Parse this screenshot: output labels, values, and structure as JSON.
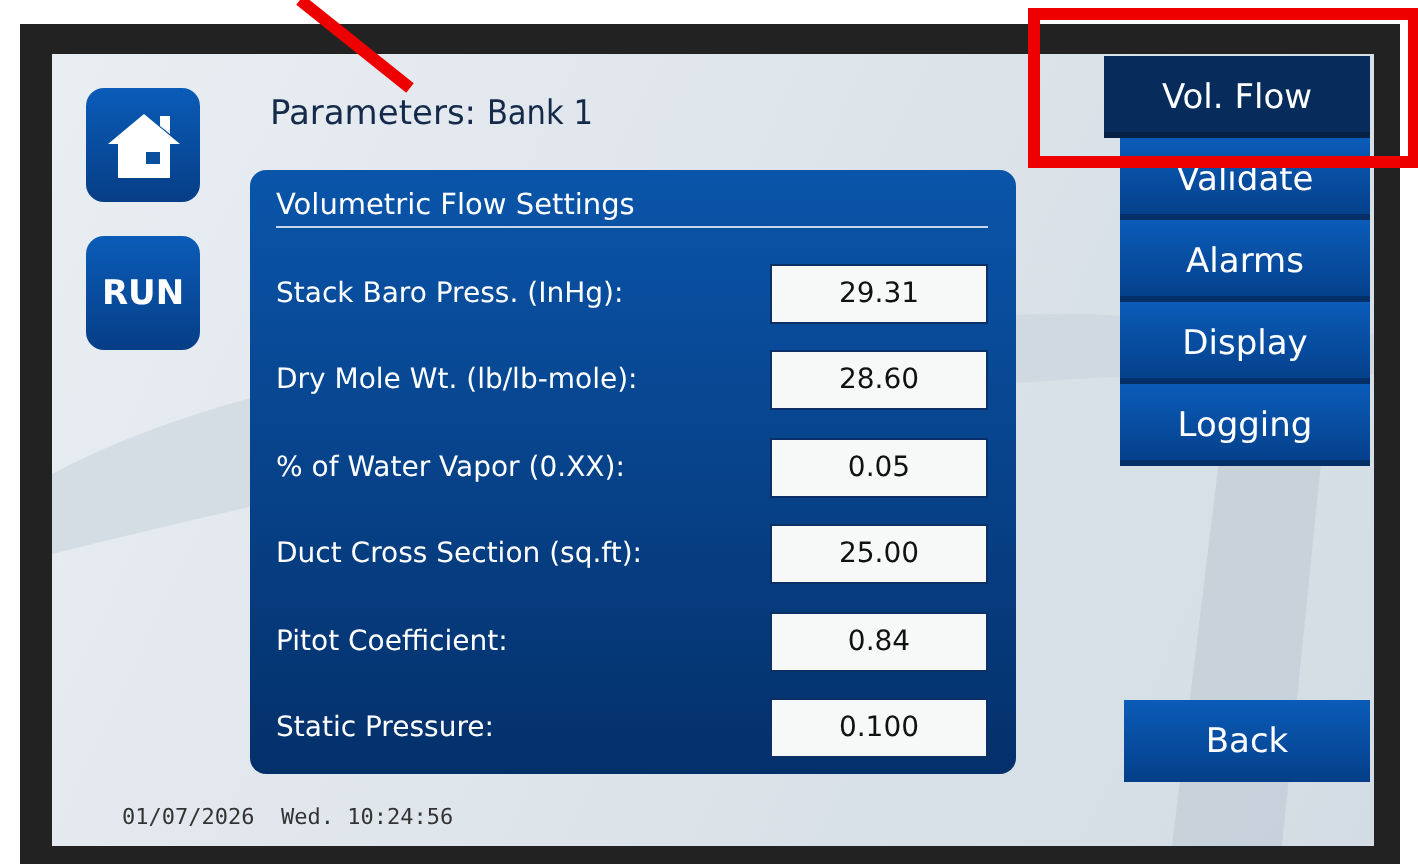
{
  "header": {
    "title": "Parameters: ",
    "bank": "Bank 1"
  },
  "side_buttons": [
    {
      "kind": "home"
    },
    {
      "kind": "text",
      "label": "RUN"
    }
  ],
  "panel": {
    "heading": "Volumetric Flow Settings",
    "rows": [
      {
        "label": "Stack Baro Press. (InHg):",
        "value": "29.31"
      },
      {
        "label": "Dry Mole Wt. (lb/lb-mole):",
        "value": "28.60"
      },
      {
        "label": "% of Water Vapor (0.XX):",
        "value": "0.05"
      },
      {
        "label": "Duct Cross Section (sq.ft):",
        "value": "25.00"
      },
      {
        "label": "Pitot Coefficient:",
        "value": "0.84"
      },
      {
        "label": "Static Pressure:",
        "value": "0.100"
      }
    ]
  },
  "tabs": [
    {
      "label": "Vol. Flow",
      "selected": true
    },
    {
      "label": "Validate",
      "selected": false
    },
    {
      "label": "Alarms",
      "selected": false
    },
    {
      "label": "Display",
      "selected": false
    },
    {
      "label": "Logging",
      "selected": false
    }
  ],
  "back_button": {
    "label": "Back"
  },
  "status_bar": {
    "datetime": "01/07/2026  Wed. 10:24:56"
  }
}
